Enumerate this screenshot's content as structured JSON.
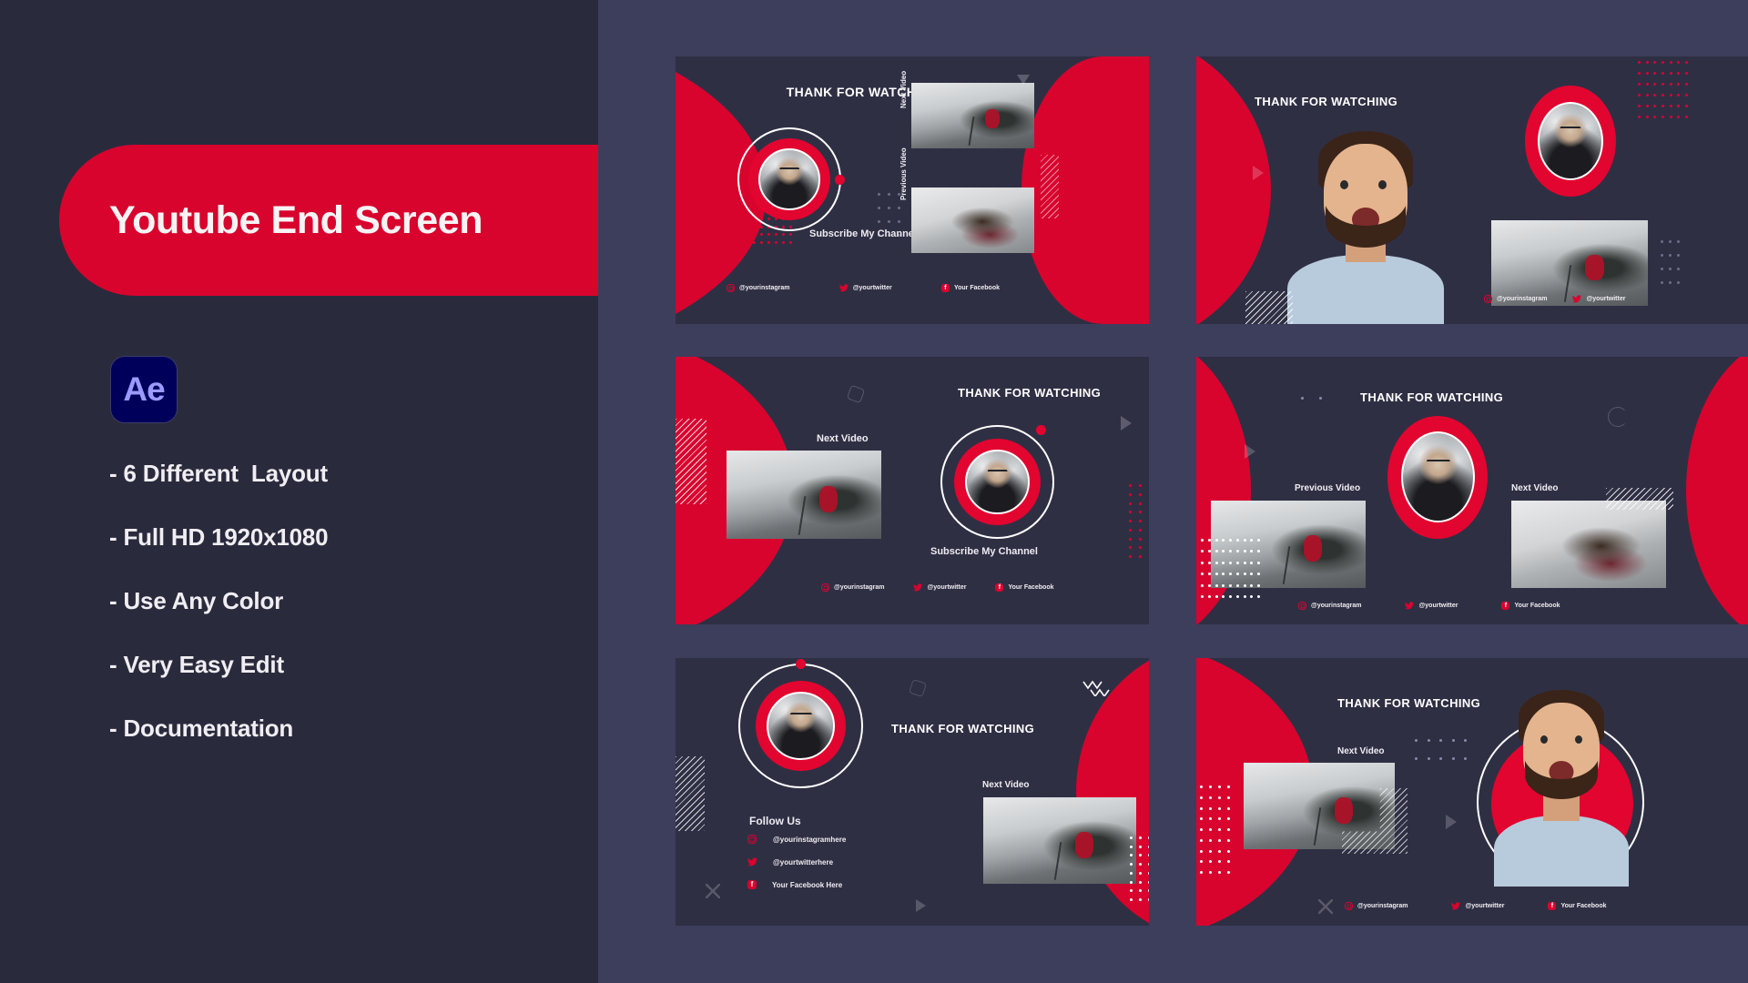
{
  "left_panel": {
    "title": "Youtube End Screen",
    "app_icon": {
      "name": "after-effects-icon",
      "label": "Ae"
    },
    "features": [
      "- 6 Different  Layout",
      "- Full HD 1920x1080",
      "- Use Any Color",
      "- Very Easy Edit",
      "- Documentation"
    ]
  },
  "colors": {
    "accent_red": "#d8042e",
    "panel_dark": "#2a2a3d",
    "panel_light": "#3d3d5c",
    "card_bg": "#2f2f44",
    "text_light": "#f0eef2",
    "ae_bg": "#00005b",
    "ae_text": "#9a9aff"
  },
  "cards": [
    {
      "id": "layout-1",
      "heading": "THANK FOR WATCHING",
      "subscribe_label": "Subscribe My Channel",
      "video_labels": [
        "Next Video",
        "Previous Video"
      ],
      "socials": [
        {
          "icon": "instagram-icon",
          "label": "@yourinstagram"
        },
        {
          "icon": "twitter-icon",
          "label": "@yourtwitter"
        },
        {
          "icon": "facebook-icon",
          "label": "Your Facebook"
        }
      ]
    },
    {
      "id": "layout-2",
      "heading": "THANK FOR WATCHING",
      "video_labels": [],
      "socials": [
        {
          "icon": "instagram-icon",
          "label": "@yourinstagram"
        },
        {
          "icon": "twitter-icon",
          "label": "@yourtwitter"
        }
      ]
    },
    {
      "id": "layout-3",
      "heading": "THANK FOR WATCHING",
      "subscribe_label": "Subscribe My Channel",
      "video_labels": [
        "Next Video"
      ],
      "socials": [
        {
          "icon": "instagram-icon",
          "label": "@yourinstagram"
        },
        {
          "icon": "twitter-icon",
          "label": "@yourtwitter"
        },
        {
          "icon": "facebook-icon",
          "label": "Your Facebook"
        }
      ]
    },
    {
      "id": "layout-4",
      "heading": "THANK FOR WATCHING",
      "video_labels": [
        "Previous Video",
        "Next Video"
      ],
      "socials": [
        {
          "icon": "instagram-icon",
          "label": "@yourinstagram"
        },
        {
          "icon": "twitter-icon",
          "label": "@yourtwitter"
        },
        {
          "icon": "facebook-icon",
          "label": "Your Facebook"
        }
      ]
    },
    {
      "id": "layout-5",
      "heading": "THANK FOR WATCHING",
      "follow_label": "Follow Us",
      "video_labels": [
        "Next Video"
      ],
      "socials": [
        {
          "icon": "instagram-icon",
          "label": "@yourinstagramhere"
        },
        {
          "icon": "twitter-icon",
          "label": "@yourtwitterhere"
        },
        {
          "icon": "facebook-icon",
          "label": "Your Facebook Here"
        }
      ]
    },
    {
      "id": "layout-6",
      "heading": "THANK FOR WATCHING",
      "video_labels": [
        "Next Video"
      ],
      "socials": [
        {
          "icon": "instagram-icon",
          "label": "@yourinstagram"
        },
        {
          "icon": "twitter-icon",
          "label": "@yourtwitter"
        },
        {
          "icon": "facebook-icon",
          "label": "Your Facebook"
        }
      ]
    }
  ]
}
